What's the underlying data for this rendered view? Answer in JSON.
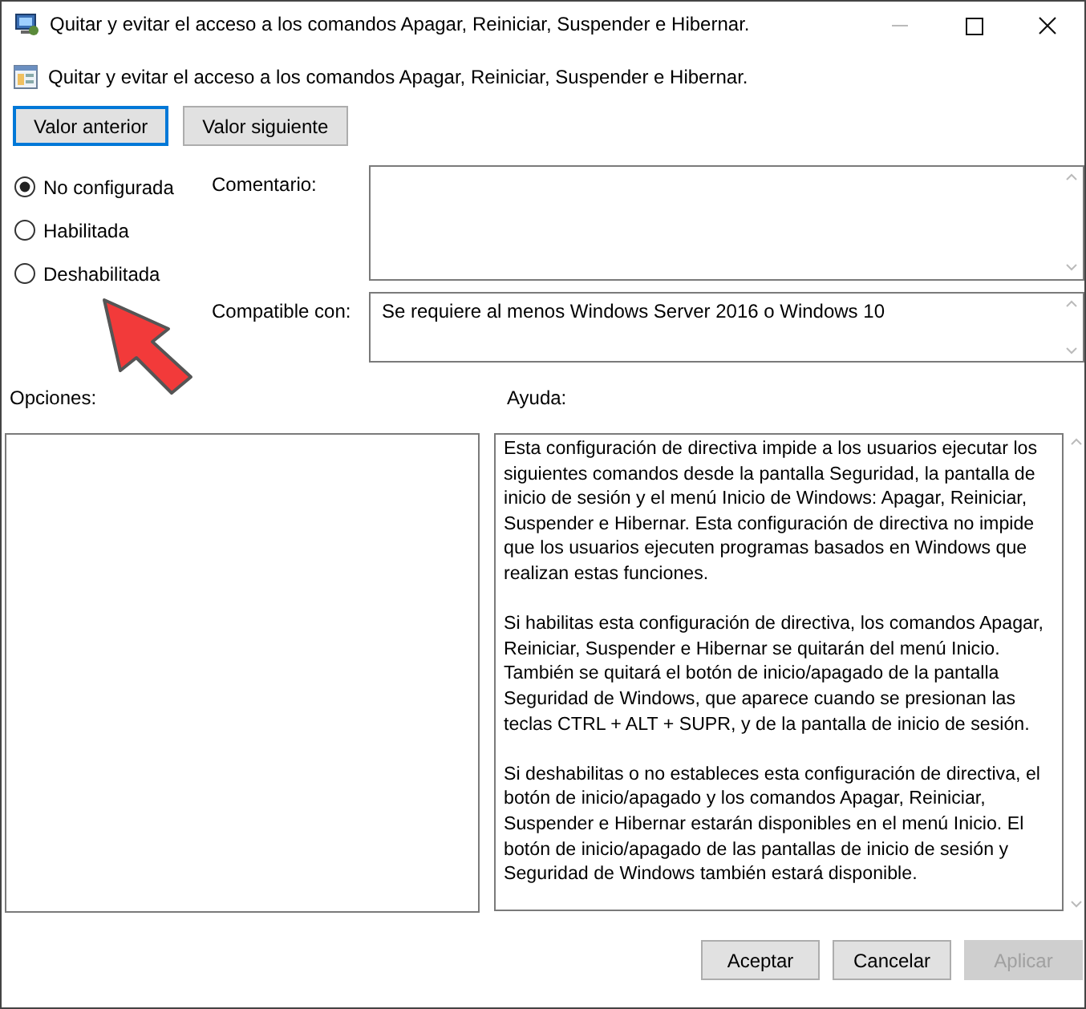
{
  "window": {
    "title": "Quitar y evitar el acceso a los comandos Apagar, Reiniciar, Suspender e Hibernar."
  },
  "heading": "Quitar y evitar el acceso a los comandos Apagar, Reiniciar, Suspender e Hibernar.",
  "nav_buttons": [
    {
      "label": "Valor anterior",
      "focused": true
    },
    {
      "label": "Valor siguiente",
      "focused": false
    }
  ],
  "settings": [
    {
      "label": "No configurada",
      "selected": true
    },
    {
      "label": "Habilitada",
      "selected": false
    },
    {
      "label": "Deshabilitada",
      "selected": false
    }
  ],
  "comment": {
    "label": "Comentario:"
  },
  "compatible": {
    "label": "Compatible con:",
    "value": "Se requiere al menos Windows Server 2016 o Windows 10"
  },
  "options": {
    "label": "Opciones:"
  },
  "help": {
    "label": "Ayuda:",
    "paragraphs": [
      "Esta configuración de directiva impide a los usuarios ejecutar los siguientes comandos desde la pantalla Seguridad, la pantalla de inicio de sesión y el menú Inicio de Windows: Apagar, Reiniciar, Suspender e Hibernar. Esta configuración de directiva no impide que los usuarios ejecuten programas basados en Windows que realizan estas funciones.",
      "Si habilitas esta configuración de directiva, los comandos Apagar, Reiniciar, Suspender e Hibernar se quitarán del menú Inicio. También se quitará el botón de inicio/apagado de la pantalla Seguridad de Windows, que aparece cuando se presionan las teclas CTRL + ALT + SUPR, y de la pantalla de inicio de sesión.",
      "Si deshabilitas o no estableces esta configuración de directiva, el botón de inicio/apagado y los comandos Apagar, Reiniciar, Suspender e Hibernar estarán disponibles en el menú Inicio. El botón de inicio/apagado de las pantallas de inicio de sesión y Seguridad de Windows también estará disponible."
    ]
  },
  "buttons": [
    {
      "label": "Aceptar",
      "disabled": false
    },
    {
      "label": "Cancelar",
      "disabled": false
    },
    {
      "label": "Aplicar",
      "disabled": true
    }
  ]
}
